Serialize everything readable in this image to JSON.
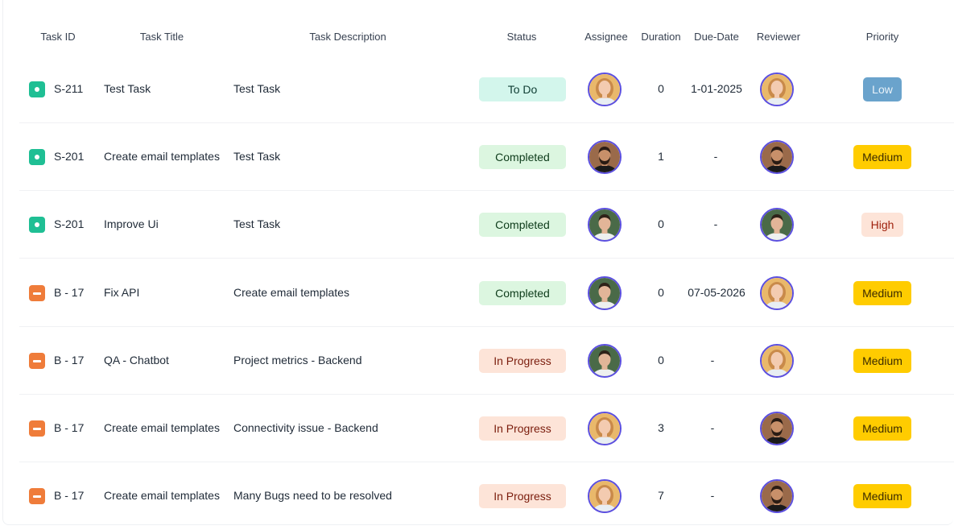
{
  "columns": [
    "Task ID",
    "Task Title",
    "Task Description",
    "Status",
    "Assignee",
    "Duration",
    "Due-Date",
    "Reviewer",
    "Priority"
  ],
  "status_styles": {
    "To Do": {
      "bg": "#d3f6ec",
      "fg": "#0f3d33"
    },
    "Completed": {
      "bg": "#dcf6e0",
      "fg": "#0d3b1a"
    },
    "In Progress": {
      "bg": "#fde4d8",
      "fg": "#7a1c0c"
    }
  },
  "priority_styles": {
    "Low": {
      "bg": "#6aa3cc",
      "fg": "#e9f2f9",
      "w": 48
    },
    "Medium": {
      "bg": "#ffcc00",
      "fg": "#3a2a00",
      "w": 72
    },
    "High": {
      "bg": "#fde4d8",
      "fg": "#9e1f0b",
      "w": 52
    }
  },
  "avatars": {
    "woman": {
      "bg": "#e9b86b",
      "skin": "#f3cbb0",
      "hair": "#c98a4a",
      "shirt": "#e8eef3"
    },
    "man-beard": {
      "bg": "#9a6a4a",
      "skin": "#c8906a",
      "hair": "#2a1c14",
      "shirt": "#1a1a1a"
    },
    "man-young": {
      "bg": "#4a6a48",
      "skin": "#e2b598",
      "hair": "#2e2218",
      "shirt": "#eef0ef"
    }
  },
  "rows": [
    {
      "type": "story",
      "id": "S-211",
      "title": "Test Task",
      "description": "Test Task",
      "status": "To Do",
      "assignee": "woman",
      "duration": "0",
      "due": "1-01-2025",
      "reviewer": "woman",
      "priority": "Low"
    },
    {
      "type": "story",
      "id": "S-201",
      "title": "Create email templates",
      "description": "Test Task",
      "status": "Completed",
      "assignee": "man-beard",
      "duration": "1",
      "due": "-",
      "reviewer": "man-beard",
      "priority": "Medium"
    },
    {
      "type": "story",
      "id": "S-201",
      "title": "Improve Ui",
      "description": "Test Task",
      "status": "Completed",
      "assignee": "man-young",
      "duration": "0",
      "due": "-",
      "reviewer": "man-young",
      "priority": "High"
    },
    {
      "type": "bug",
      "id": "B - 17",
      "title": "Fix API",
      "description": "Create email templates",
      "status": "Completed",
      "assignee": "man-young",
      "duration": "0",
      "due": "07-05-2026",
      "reviewer": "woman",
      "priority": "Medium"
    },
    {
      "type": "bug",
      "id": "B - 17",
      "title": "QA - Chatbot",
      "description": "Project metrics - Backend",
      "status": "In Progress",
      "assignee": "man-young",
      "duration": "0",
      "due": "-",
      "reviewer": "woman",
      "priority": "Medium"
    },
    {
      "type": "bug",
      "id": "B - 17",
      "title": "Create email templates",
      "description": "Connectivity issue - Backend",
      "status": "In Progress",
      "assignee": "woman",
      "duration": "3",
      "due": "-",
      "reviewer": "man-beard",
      "priority": "Medium"
    },
    {
      "type": "bug",
      "id": "B - 17",
      "title": "Create email templates",
      "description": "Many Bugs need to be resolved",
      "status": "In Progress",
      "assignee": "woman",
      "duration": "7",
      "due": "-",
      "reviewer": "man-beard",
      "priority": "Medium"
    }
  ]
}
